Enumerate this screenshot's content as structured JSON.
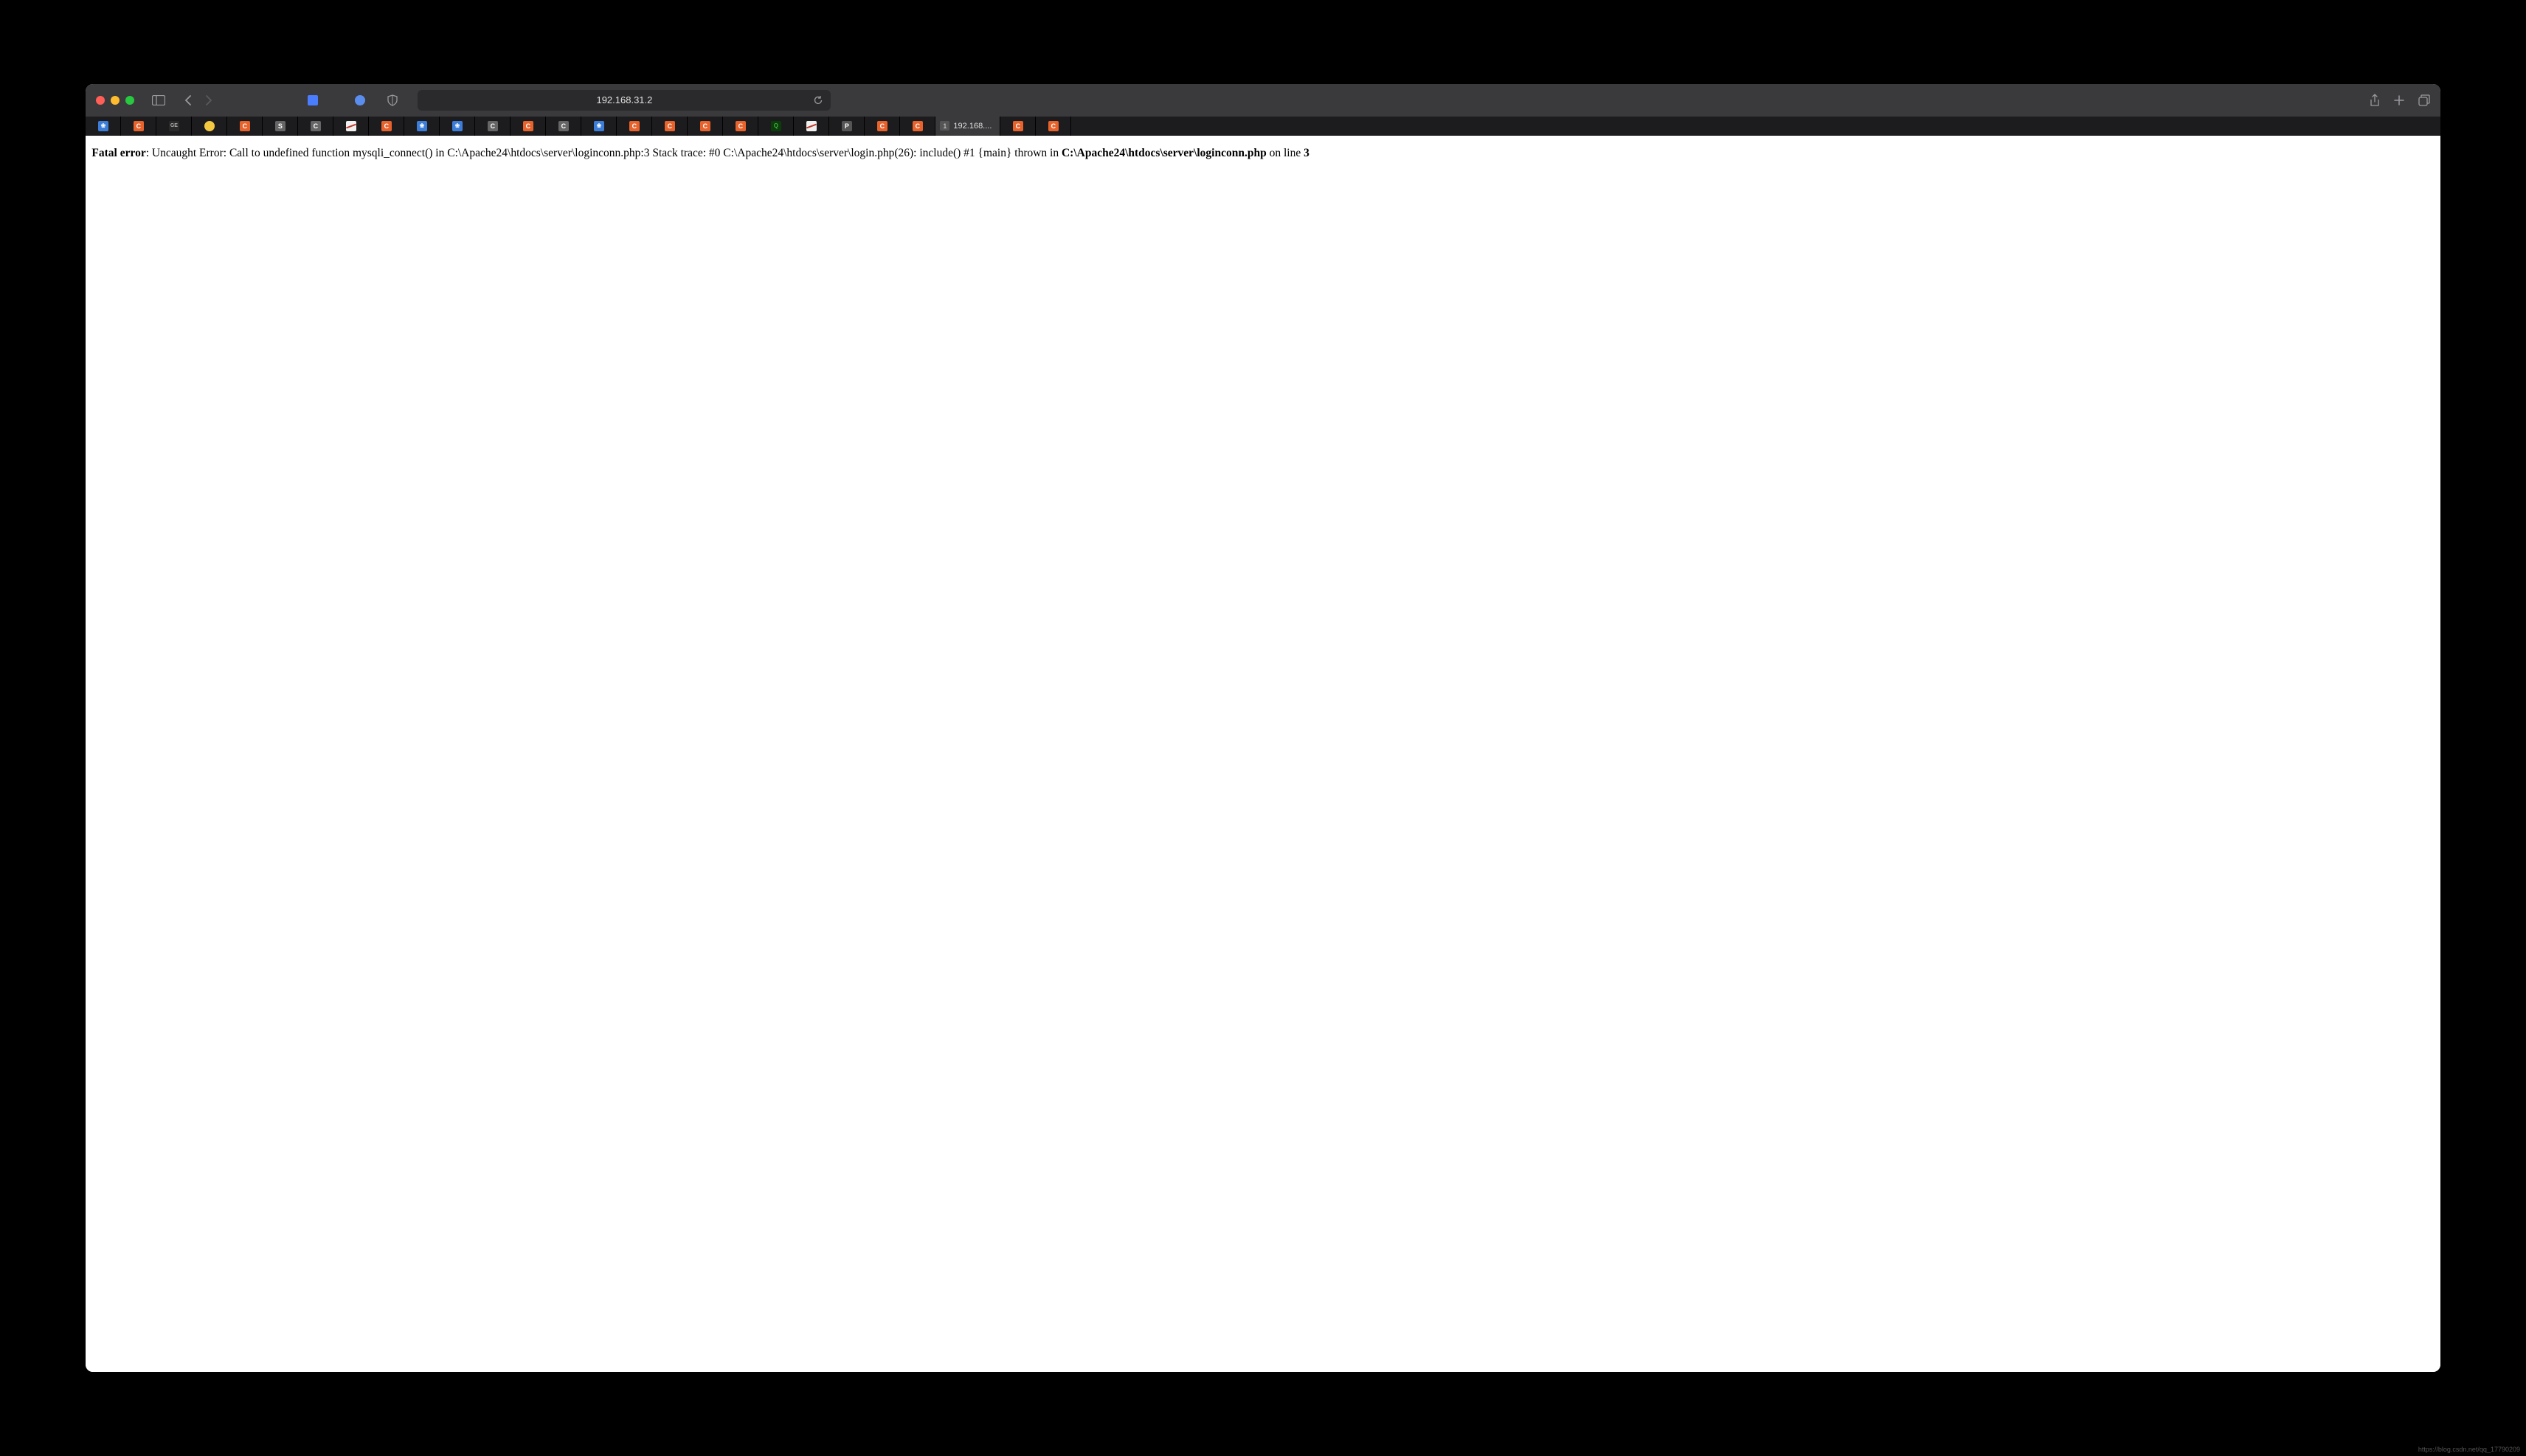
{
  "titlebar": {
    "address": "192.168.31.2"
  },
  "tabs": {
    "active_count": "1",
    "active_label": "192.168....",
    "items": [
      {
        "type": "blue"
      },
      {
        "type": "c"
      },
      {
        "type": "dark"
      },
      {
        "type": "yellow"
      },
      {
        "type": "c"
      },
      {
        "type": "s"
      },
      {
        "type": "c-grey"
      },
      {
        "type": "white"
      },
      {
        "type": "c"
      },
      {
        "type": "blue"
      },
      {
        "type": "blue"
      },
      {
        "type": "c-grey"
      },
      {
        "type": "c"
      },
      {
        "type": "c-grey"
      },
      {
        "type": "blue"
      },
      {
        "type": "c"
      },
      {
        "type": "c"
      },
      {
        "type": "c"
      },
      {
        "type": "c"
      },
      {
        "type": "green"
      },
      {
        "type": "white"
      },
      {
        "type": "p"
      },
      {
        "type": "c"
      },
      {
        "type": "c"
      }
    ],
    "after_active": [
      {
        "type": "c"
      },
      {
        "type": "c"
      }
    ]
  },
  "error": {
    "prefix": "Fatal error",
    "colon": ": ",
    "message": "Uncaught Error: Call to undefined function mysqli_connect() in C:\\Apache24\\htdocs\\server\\loginconn.php:3 Stack trace: #0 C:\\Apache24\\htdocs\\server\\login.php(26): include() #1 {main} thrown in ",
    "file": "C:\\Apache24\\htdocs\\server\\loginconn.php",
    "on_line": " on line ",
    "line": "3"
  },
  "watermark": "https://blog.csdn.net/qq_17790209"
}
